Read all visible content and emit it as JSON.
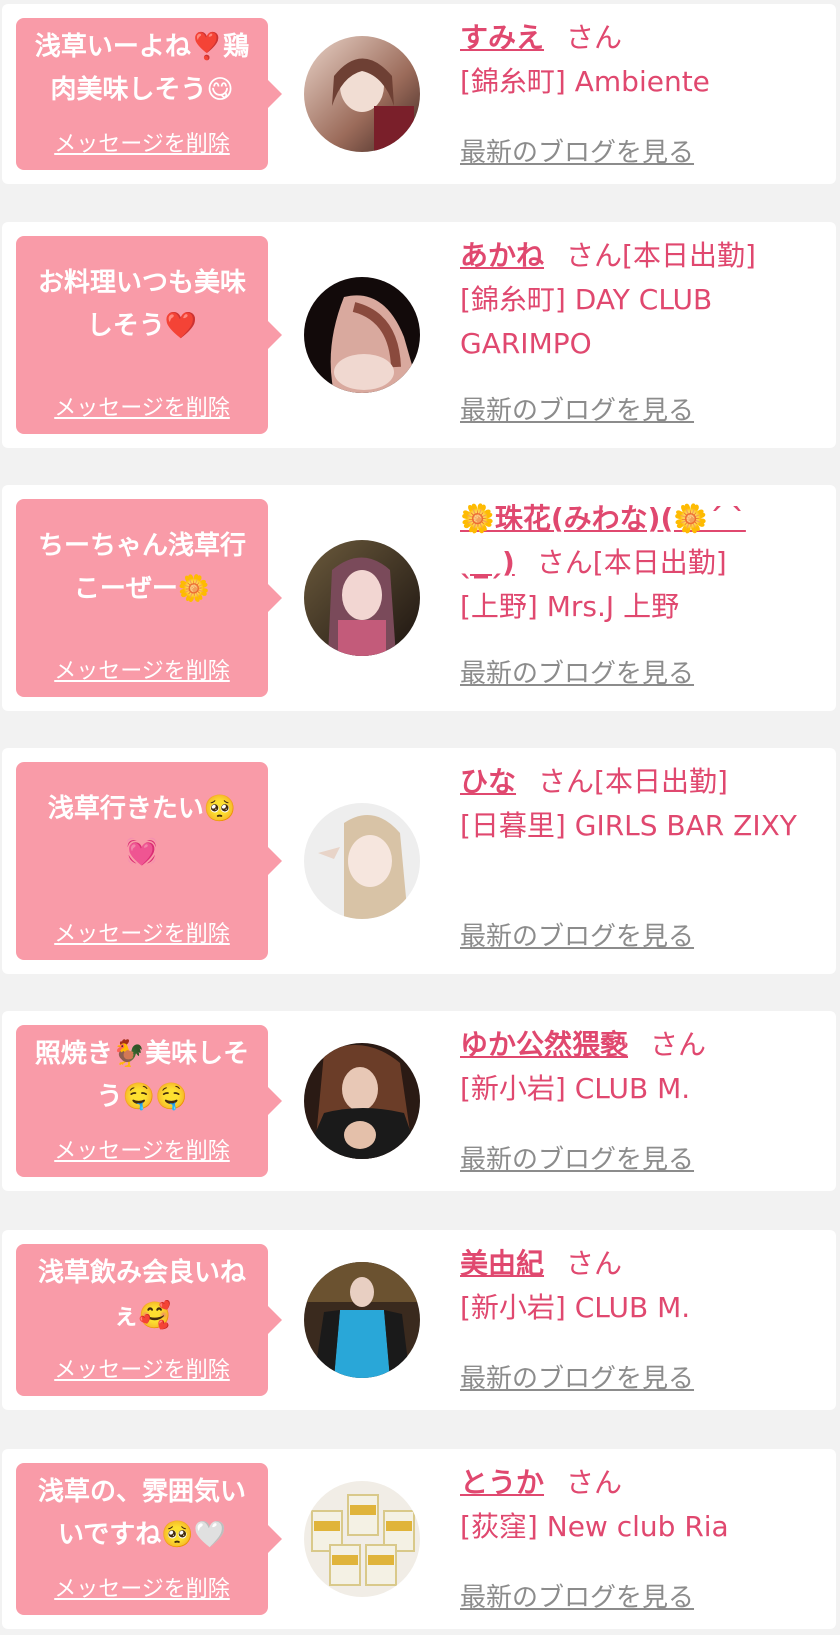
{
  "delete_label": "メッセージを削除",
  "blog_label": "最新のブログを見る",
  "colors": {
    "bubble": "#f99ba8",
    "accent": "#e0486f",
    "link_gray": "#8c8c8c",
    "background": "#f2f2f2"
  },
  "items": [
    {
      "message": "浅草いーよね❣️鶏\n肉美味しそう😋",
      "name": "すみえ",
      "suffix": "さん",
      "shop": "[錦糸町] Ambiente"
    },
    {
      "message": "お料理いつも美味\nしそう❤️",
      "name": "あかね",
      "suffix": "さん[本日出勤]",
      "shop": "[錦糸町] DAY CLUB GARIMPO"
    },
    {
      "message": "ちーちゃん浅草行\nこーぜー🌼",
      "name": "🌼珠花(みわな)(🌼ˊ ˋ ˎ_ˏ)",
      "suffix": "さん[本日出勤]",
      "shop": "[上野] Mrs.J 上野"
    },
    {
      "message": "浅草行きたい🥺\n💓",
      "name": "ひな",
      "suffix": "さん[本日出勤]",
      "shop": "[日暮里] GIRLS BAR ZIXY"
    },
    {
      "message": "照焼き🐓美味しそ\nう🤤🤤",
      "name": "ゆか公然猥褻",
      "suffix": "さん",
      "shop": "[新小岩] CLUB M."
    },
    {
      "message": "浅草飲み会良いね\nぇ🥰",
      "name": "美由紀",
      "suffix": "さん",
      "shop": "[新小岩] CLUB M."
    },
    {
      "message": "浅草の、雰囲気い\nいですね🥺🤍",
      "name": "とうか",
      "suffix": "さん",
      "shop": "[荻窪] New club Ria"
    }
  ]
}
